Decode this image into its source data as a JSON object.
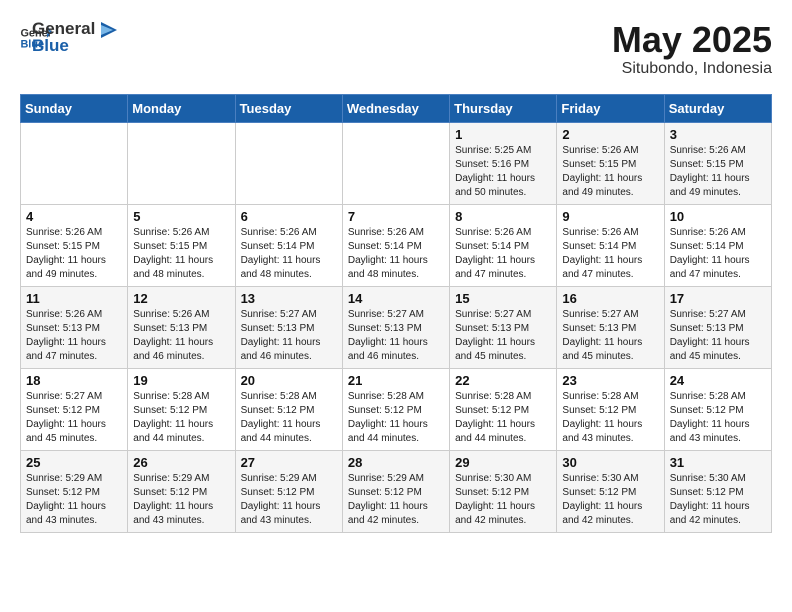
{
  "header": {
    "logo_general": "General",
    "logo_blue": "Blue",
    "month_year": "May 2025",
    "location": "Situbondo, Indonesia"
  },
  "weekdays": [
    "Sunday",
    "Monday",
    "Tuesday",
    "Wednesday",
    "Thursday",
    "Friday",
    "Saturday"
  ],
  "weeks": [
    [
      {
        "day": "",
        "info": ""
      },
      {
        "day": "",
        "info": ""
      },
      {
        "day": "",
        "info": ""
      },
      {
        "day": "",
        "info": ""
      },
      {
        "day": "1",
        "info": "Sunrise: 5:25 AM\nSunset: 5:16 PM\nDaylight: 11 hours\nand 50 minutes."
      },
      {
        "day": "2",
        "info": "Sunrise: 5:26 AM\nSunset: 5:15 PM\nDaylight: 11 hours\nand 49 minutes."
      },
      {
        "day": "3",
        "info": "Sunrise: 5:26 AM\nSunset: 5:15 PM\nDaylight: 11 hours\nand 49 minutes."
      }
    ],
    [
      {
        "day": "4",
        "info": "Sunrise: 5:26 AM\nSunset: 5:15 PM\nDaylight: 11 hours\nand 49 minutes."
      },
      {
        "day": "5",
        "info": "Sunrise: 5:26 AM\nSunset: 5:15 PM\nDaylight: 11 hours\nand 48 minutes."
      },
      {
        "day": "6",
        "info": "Sunrise: 5:26 AM\nSunset: 5:14 PM\nDaylight: 11 hours\nand 48 minutes."
      },
      {
        "day": "7",
        "info": "Sunrise: 5:26 AM\nSunset: 5:14 PM\nDaylight: 11 hours\nand 48 minutes."
      },
      {
        "day": "8",
        "info": "Sunrise: 5:26 AM\nSunset: 5:14 PM\nDaylight: 11 hours\nand 47 minutes."
      },
      {
        "day": "9",
        "info": "Sunrise: 5:26 AM\nSunset: 5:14 PM\nDaylight: 11 hours\nand 47 minutes."
      },
      {
        "day": "10",
        "info": "Sunrise: 5:26 AM\nSunset: 5:14 PM\nDaylight: 11 hours\nand 47 minutes."
      }
    ],
    [
      {
        "day": "11",
        "info": "Sunrise: 5:26 AM\nSunset: 5:13 PM\nDaylight: 11 hours\nand 47 minutes."
      },
      {
        "day": "12",
        "info": "Sunrise: 5:26 AM\nSunset: 5:13 PM\nDaylight: 11 hours\nand 46 minutes."
      },
      {
        "day": "13",
        "info": "Sunrise: 5:27 AM\nSunset: 5:13 PM\nDaylight: 11 hours\nand 46 minutes."
      },
      {
        "day": "14",
        "info": "Sunrise: 5:27 AM\nSunset: 5:13 PM\nDaylight: 11 hours\nand 46 minutes."
      },
      {
        "day": "15",
        "info": "Sunrise: 5:27 AM\nSunset: 5:13 PM\nDaylight: 11 hours\nand 45 minutes."
      },
      {
        "day": "16",
        "info": "Sunrise: 5:27 AM\nSunset: 5:13 PM\nDaylight: 11 hours\nand 45 minutes."
      },
      {
        "day": "17",
        "info": "Sunrise: 5:27 AM\nSunset: 5:13 PM\nDaylight: 11 hours\nand 45 minutes."
      }
    ],
    [
      {
        "day": "18",
        "info": "Sunrise: 5:27 AM\nSunset: 5:12 PM\nDaylight: 11 hours\nand 45 minutes."
      },
      {
        "day": "19",
        "info": "Sunrise: 5:28 AM\nSunset: 5:12 PM\nDaylight: 11 hours\nand 44 minutes."
      },
      {
        "day": "20",
        "info": "Sunrise: 5:28 AM\nSunset: 5:12 PM\nDaylight: 11 hours\nand 44 minutes."
      },
      {
        "day": "21",
        "info": "Sunrise: 5:28 AM\nSunset: 5:12 PM\nDaylight: 11 hours\nand 44 minutes."
      },
      {
        "day": "22",
        "info": "Sunrise: 5:28 AM\nSunset: 5:12 PM\nDaylight: 11 hours\nand 44 minutes."
      },
      {
        "day": "23",
        "info": "Sunrise: 5:28 AM\nSunset: 5:12 PM\nDaylight: 11 hours\nand 43 minutes."
      },
      {
        "day": "24",
        "info": "Sunrise: 5:28 AM\nSunset: 5:12 PM\nDaylight: 11 hours\nand 43 minutes."
      }
    ],
    [
      {
        "day": "25",
        "info": "Sunrise: 5:29 AM\nSunset: 5:12 PM\nDaylight: 11 hours\nand 43 minutes."
      },
      {
        "day": "26",
        "info": "Sunrise: 5:29 AM\nSunset: 5:12 PM\nDaylight: 11 hours\nand 43 minutes."
      },
      {
        "day": "27",
        "info": "Sunrise: 5:29 AM\nSunset: 5:12 PM\nDaylight: 11 hours\nand 43 minutes."
      },
      {
        "day": "28",
        "info": "Sunrise: 5:29 AM\nSunset: 5:12 PM\nDaylight: 11 hours\nand 42 minutes."
      },
      {
        "day": "29",
        "info": "Sunrise: 5:30 AM\nSunset: 5:12 PM\nDaylight: 11 hours\nand 42 minutes."
      },
      {
        "day": "30",
        "info": "Sunrise: 5:30 AM\nSunset: 5:12 PM\nDaylight: 11 hours\nand 42 minutes."
      },
      {
        "day": "31",
        "info": "Sunrise: 5:30 AM\nSunset: 5:12 PM\nDaylight: 11 hours\nand 42 minutes."
      }
    ]
  ]
}
